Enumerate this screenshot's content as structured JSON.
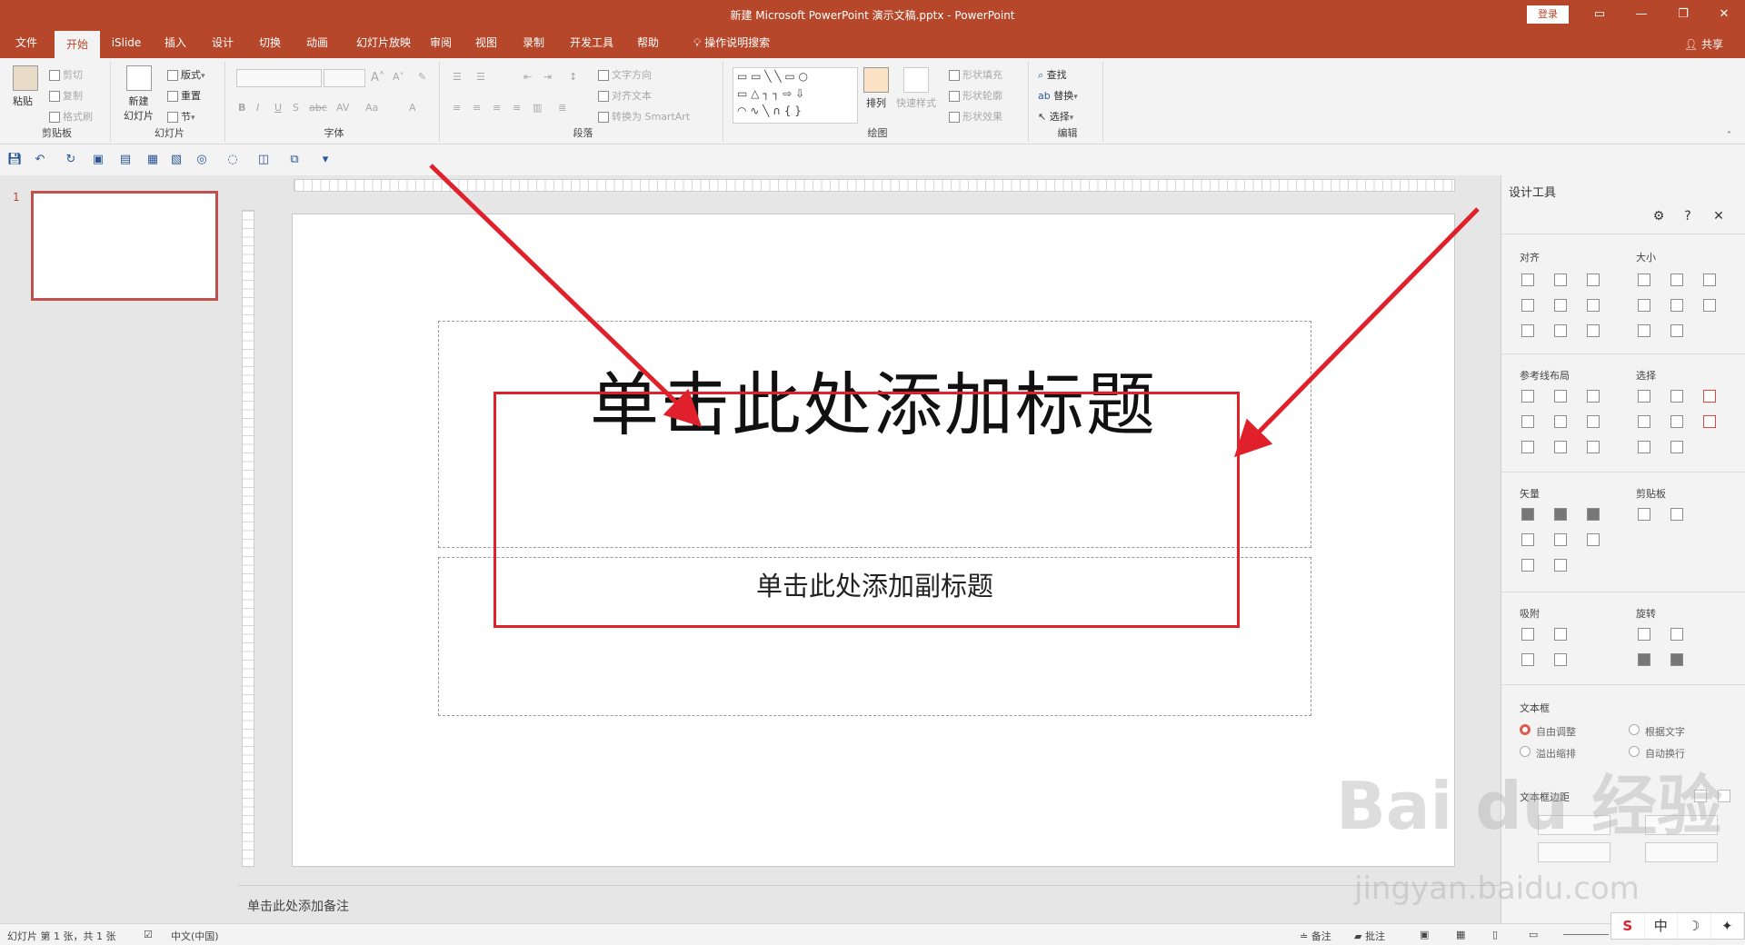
{
  "window": {
    "title": "新建 Microsoft PowerPoint 演示文稿.pptx  -  PowerPoint",
    "login": "登录"
  },
  "tabs": [
    "文件",
    "开始",
    "iSlide",
    "插入",
    "设计",
    "切换",
    "动画",
    "幻灯片放映",
    "审阅",
    "视图",
    "录制",
    "开发工具",
    "帮助",
    "操作说明搜索"
  ],
  "share": "共享",
  "ribbon": {
    "clipboard": {
      "paste": "粘贴",
      "cut": "剪切",
      "copy": "复制",
      "format_painter": "格式刷",
      "label": "剪贴板"
    },
    "slides": {
      "new_slide_1": "新建",
      "new_slide_2": "幻灯片",
      "layout": "版式",
      "reset": "重置",
      "section": "节",
      "label": "幻灯片"
    },
    "font": {
      "label": "字体"
    },
    "paragraph": {
      "text_direction": "文字方向",
      "align_text": "对齐文本",
      "smartart": "转换为 SmartArt",
      "label": "段落"
    },
    "drawing": {
      "arrange": "排列",
      "quick_styles": "快速样式",
      "fill": "形状填充",
      "outline": "形状轮廓",
      "effects": "形状效果",
      "label": "绘图"
    },
    "editing": {
      "find": "查找",
      "replace": "替换",
      "select": "选择",
      "label": "编辑"
    }
  },
  "slide_panel": {
    "number": "1"
  },
  "slide": {
    "title_placeholder": "单击此处添加标题",
    "subtitle_placeholder": "单击此处添加副标题"
  },
  "notes": "单击此处添加备注",
  "design_tools": {
    "header": "设计工具",
    "align": "对齐",
    "size": "大小",
    "guides": "参考线布局",
    "select": "选择",
    "vector": "矢量",
    "clipboard": "剪贴板",
    "snap": "吸附",
    "rotate": "旋转",
    "textbox": "文本框",
    "auto_fit": "自由调整",
    "fit_text": "根据文字",
    "overflow": "溢出缩排",
    "auto_wrap": "自动换行",
    "margins": "文本框边距"
  },
  "status": {
    "slide_info": "幻灯片 第 1 张，共 1 张",
    "language": "中文(中国)",
    "notes_btn": "备注",
    "comments_btn": "批注"
  },
  "ime": [
    "S",
    "中",
    "☽",
    "✦"
  ],
  "watermark": {
    "brand": "Bai du 经验",
    "url": "jingyan.baidu.com"
  },
  "accent_colors": {
    "ppt_orange": "#b7472a",
    "annotation_red": "#e0212b"
  }
}
